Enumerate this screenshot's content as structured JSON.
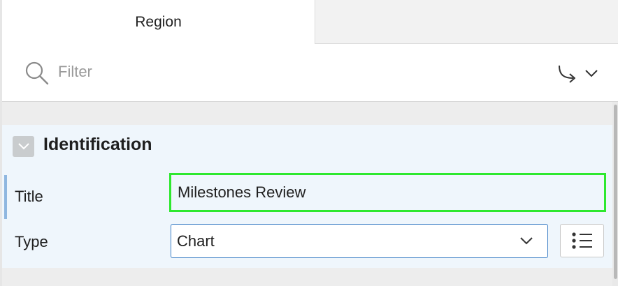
{
  "tabs": [
    {
      "label": "Region",
      "active": true
    }
  ],
  "search": {
    "placeholder": "Filter",
    "value": "",
    "icon": "search-icon",
    "goto_icon": "arrow-go-to-icon",
    "dropdown_icon": "chevron-down-icon"
  },
  "section": {
    "title": "Identification",
    "toggle_icon": "chevron-down-icon",
    "fields": {
      "title": {
        "label": "Title",
        "value": "Milestones Review"
      },
      "type": {
        "label": "Type",
        "value": "Chart",
        "options": [
          "Chart"
        ]
      }
    },
    "list_icon": "list-icon"
  },
  "colors": {
    "highlight": "#2ee82e",
    "section_bg": "#eff6fc",
    "select_border": "#3d7fc6",
    "row_indicator": "#8fb7e0"
  }
}
